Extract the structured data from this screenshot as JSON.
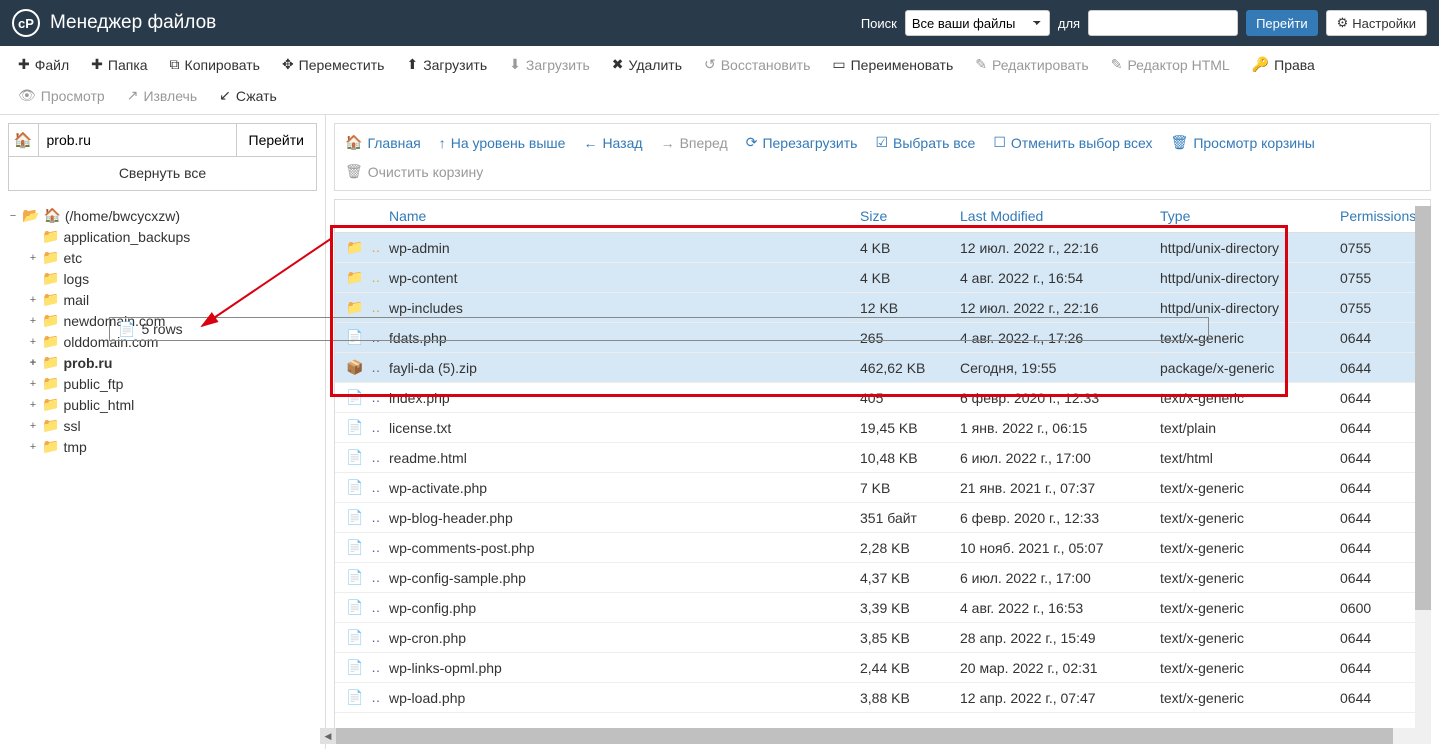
{
  "header": {
    "title": "Менеджер файлов",
    "search_label": "Поиск",
    "search_options": [
      "Все ваши файлы"
    ],
    "search_selected": "Все ваши файлы",
    "for_label": "для",
    "go_label": "Перейти",
    "settings_label": "Настройки"
  },
  "toolbar": [
    {
      "icon": "plus",
      "label": "Файл",
      "disabled": false
    },
    {
      "icon": "plus",
      "label": "Папка",
      "disabled": false
    },
    {
      "icon": "copy",
      "label": "Копировать",
      "disabled": false
    },
    {
      "icon": "move",
      "label": "Переместить",
      "disabled": false
    },
    {
      "icon": "upload",
      "label": "Загрузить",
      "disabled": false
    },
    {
      "icon": "download",
      "label": "Загрузить",
      "disabled": true
    },
    {
      "icon": "delete",
      "label": "Удалить",
      "disabled": false
    },
    {
      "icon": "restore",
      "label": "Восстановить",
      "disabled": true
    },
    {
      "icon": "rename",
      "label": "Переименовать",
      "disabled": false
    },
    {
      "icon": "edit",
      "label": "Редактировать",
      "disabled": true
    },
    {
      "icon": "htmledit",
      "label": "Редактор HTML",
      "disabled": true
    },
    {
      "icon": "perm",
      "label": "Права",
      "disabled": false
    },
    {
      "icon": "view",
      "label": "Просмотр",
      "disabled": true
    },
    {
      "icon": "extract",
      "label": "Извлечь",
      "disabled": true
    },
    {
      "icon": "compress",
      "label": "Сжать",
      "disabled": false
    }
  ],
  "sidebar": {
    "path_value": "prob.ru",
    "go_label": "Перейти",
    "collapse_label": "Свернуть все",
    "root_label": "(/home/bwcycxzw)",
    "items": [
      {
        "label": "application_backups",
        "expandable": false
      },
      {
        "label": "etc",
        "expandable": true
      },
      {
        "label": "logs",
        "expandable": false
      },
      {
        "label": "mail",
        "expandable": true
      },
      {
        "label": "newdomain.com",
        "expandable": true
      },
      {
        "label": "olddomain.com",
        "expandable": true
      },
      {
        "label": "prob.ru",
        "expandable": true,
        "bold": true
      },
      {
        "label": "public_ftp",
        "expandable": true
      },
      {
        "label": "public_html",
        "expandable": true
      },
      {
        "label": "ssl",
        "expandable": true
      },
      {
        "label": "tmp",
        "expandable": true
      }
    ]
  },
  "navbar": [
    {
      "icon": "home",
      "label": "Главная",
      "disabled": false
    },
    {
      "icon": "up",
      "label": "На уровень выше",
      "disabled": false
    },
    {
      "icon": "back",
      "label": "Назад",
      "disabled": false
    },
    {
      "icon": "forward",
      "label": "Вперед",
      "disabled": true
    },
    {
      "icon": "reload",
      "label": "Перезагрузить",
      "disabled": false
    },
    {
      "icon": "selectall",
      "label": "Выбрать все",
      "disabled": false
    },
    {
      "icon": "unselect",
      "label": "Отменить выбор всех",
      "disabled": false
    },
    {
      "icon": "trash",
      "label": "Просмотр корзины",
      "disabled": false
    },
    {
      "icon": "empty",
      "label": "Очистить корзину",
      "disabled": true
    }
  ],
  "columns": {
    "name": "Name",
    "size": "Size",
    "modified": "Last Modified",
    "type": "Type",
    "permissions": "Permissions"
  },
  "files": [
    {
      "kind": "folder",
      "name": "wp-admin",
      "size": "4 KB",
      "modified": "12 июл. 2022 г., 22:16",
      "type": "httpd/unix-directory",
      "perm": "0755",
      "sel": true
    },
    {
      "kind": "folder",
      "name": "wp-content",
      "size": "4 KB",
      "modified": "4 авг. 2022 г., 16:54",
      "type": "httpd/unix-directory",
      "perm": "0755",
      "sel": true
    },
    {
      "kind": "folder",
      "name": "wp-includes",
      "size": "12 KB",
      "modified": "12 июл. 2022 г., 22:16",
      "type": "httpd/unix-directory",
      "perm": "0755",
      "sel": true
    },
    {
      "kind": "file",
      "name": "fdats.php",
      "size": "265",
      "modified": "4 авг. 2022 г., 17:26",
      "type": "text/x-generic",
      "perm": "0644",
      "sel": true
    },
    {
      "kind": "zip",
      "name": "fayli-da (5).zip",
      "size": "462,62 KB",
      "modified": "Сегодня, 19:55",
      "type": "package/x-generic",
      "perm": "0644",
      "sel": true
    },
    {
      "kind": "file",
      "name": "index.php",
      "size": "405",
      "modified": "6 февр. 2020 г., 12:33",
      "type": "text/x-generic",
      "perm": "0644",
      "sel": false
    },
    {
      "kind": "file",
      "name": "license.txt",
      "size": "19,45 KB",
      "modified": "1 янв. 2022 г., 06:15",
      "type": "text/plain",
      "perm": "0644",
      "sel": false
    },
    {
      "kind": "html",
      "name": "readme.html",
      "size": "10,48 KB",
      "modified": "6 июл. 2022 г., 17:00",
      "type": "text/html",
      "perm": "0644",
      "sel": false
    },
    {
      "kind": "file",
      "name": "wp-activate.php",
      "size": "7 KB",
      "modified": "21 янв. 2021 г., 07:37",
      "type": "text/x-generic",
      "perm": "0644",
      "sel": false
    },
    {
      "kind": "file",
      "name": "wp-blog-header.php",
      "size": "351 байт",
      "modified": "6 февр. 2020 г., 12:33",
      "type": "text/x-generic",
      "perm": "0644",
      "sel": false
    },
    {
      "kind": "file",
      "name": "wp-comments-post.php",
      "size": "2,28 KB",
      "modified": "10 нояб. 2021 г., 05:07",
      "type": "text/x-generic",
      "perm": "0644",
      "sel": false
    },
    {
      "kind": "file",
      "name": "wp-config-sample.php",
      "size": "4,37 KB",
      "modified": "6 июл. 2022 г., 17:00",
      "type": "text/x-generic",
      "perm": "0644",
      "sel": false
    },
    {
      "kind": "file",
      "name": "wp-config.php",
      "size": "3,39 KB",
      "modified": "4 авг. 2022 г., 16:53",
      "type": "text/x-generic",
      "perm": "0600",
      "sel": false
    },
    {
      "kind": "file",
      "name": "wp-cron.php",
      "size": "3,85 KB",
      "modified": "28 апр. 2022 г., 15:49",
      "type": "text/x-generic",
      "perm": "0644",
      "sel": false
    },
    {
      "kind": "file",
      "name": "wp-links-opml.php",
      "size": "2,44 KB",
      "modified": "20 мар. 2022 г., 02:31",
      "type": "text/x-generic",
      "perm": "0644",
      "sel": false
    },
    {
      "kind": "file",
      "name": "wp-load.php",
      "size": "3,88 KB",
      "modified": "12 апр. 2022 г., 07:47",
      "type": "text/x-generic",
      "perm": "0644",
      "sel": false
    }
  ],
  "dragbox": {
    "count": "5",
    "label": "rows"
  },
  "icons": {
    "plus": "✚",
    "copy": "⧉",
    "move": "✥",
    "upload": "⬆",
    "download": "⬇",
    "delete": "✖",
    "restore": "↺",
    "rename": "▭",
    "edit": "✎",
    "htmledit": "✎",
    "perm": "🔑",
    "view": "👁",
    "extract": "↗",
    "compress": "↙",
    "home": "🏠",
    "up": "↑",
    "back": "←",
    "forward": "→",
    "reload": "⟳",
    "selectall": "☑",
    "unselect": "☐",
    "trash": "🗑",
    "empty": "🗑",
    "gear": "⚙",
    "folder": "📁",
    "file": "📄",
    "zip": "📦",
    "html": "📄"
  }
}
